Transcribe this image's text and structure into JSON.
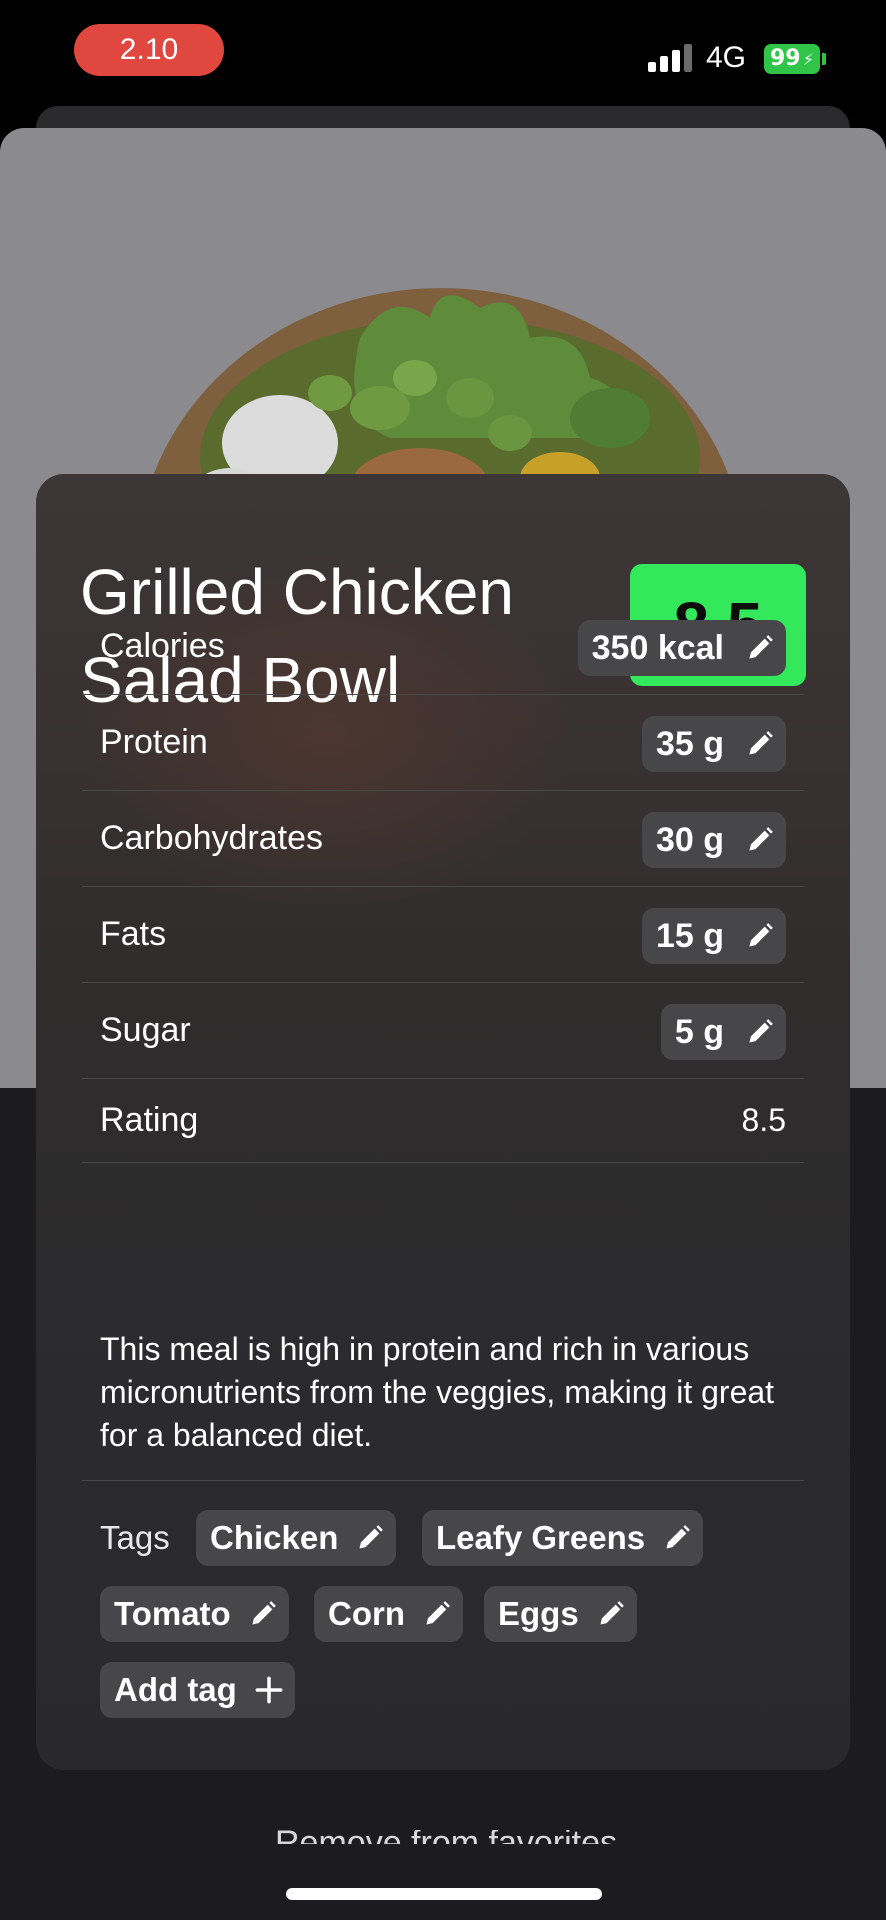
{
  "status_bar": {
    "time": "2.10",
    "network": "4G",
    "battery": "99"
  },
  "meal": {
    "title_line1": "Grilled Chicken",
    "title_line2": "Salad Bowl",
    "score": "8.5",
    "score_color": "#34e85c"
  },
  "nutrition": {
    "calories": {
      "label": "Calories",
      "value": "350 kcal"
    },
    "protein": {
      "label": "Protein",
      "value": "35 g"
    },
    "carbohydrates": {
      "label": "Carbohydrates",
      "value": "30 g"
    },
    "fats": {
      "label": "Fats",
      "value": "15 g"
    },
    "sugar": {
      "label": "Sugar",
      "value": "5 g"
    }
  },
  "rating": {
    "label": "Rating",
    "value": "8.5"
  },
  "description": "This meal is high in protein and rich in various micronutrients from the veggies, making it great for a balanced diet.",
  "tags": {
    "label": "Tags",
    "items": [
      "Chicken",
      "Leafy Greens",
      "Tomato",
      "Corn",
      "Eggs"
    ],
    "add_label": "Add tag"
  },
  "footer": {
    "partial_text": "Remove from favorites"
  },
  "icons": {
    "edit": "pencil-icon",
    "add": "plus-icon"
  }
}
